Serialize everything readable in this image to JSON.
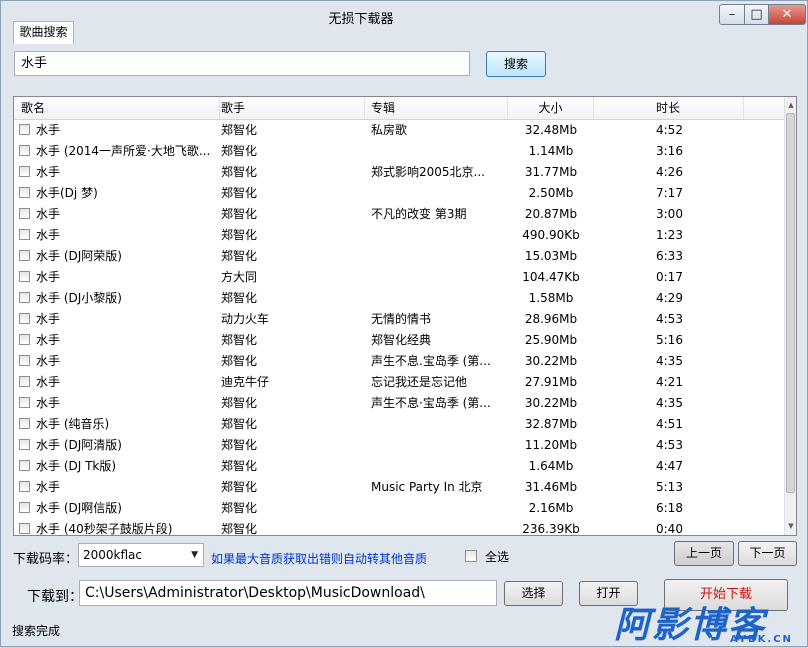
{
  "window": {
    "title": "无损下载器",
    "min_glyph": "–",
    "max_glyph": "□",
    "close_glyph": "✕"
  },
  "tab": {
    "label": "歌曲搜索"
  },
  "search": {
    "value": "水手",
    "button_label": "搜索"
  },
  "list": {
    "columns": [
      "歌名",
      "歌手",
      "专辑",
      "大小",
      "时长"
    ],
    "rows": [
      {
        "title": "水手",
        "artist": "郑智化",
        "album": "私房歌",
        "size": "32.48Mb",
        "duration": "4:52"
      },
      {
        "title": "水手 (2014一声所爱·大地飞歌...",
        "artist": "郑智化",
        "album": "",
        "size": "1.14Mb",
        "duration": "3:16"
      },
      {
        "title": "水手",
        "artist": "郑智化",
        "album": "郑式影响2005北京...",
        "size": "31.77Mb",
        "duration": "4:26"
      },
      {
        "title": "水手(Dj 梦)",
        "artist": "郑智化",
        "album": "",
        "size": "2.50Mb",
        "duration": "7:17"
      },
      {
        "title": "水手",
        "artist": "郑智化",
        "album": "不凡的改变 第3期",
        "size": "20.87Mb",
        "duration": "3:00"
      },
      {
        "title": "水手",
        "artist": "郑智化",
        "album": "",
        "size": "490.90Kb",
        "duration": "1:23"
      },
      {
        "title": "水手 (DJ阿荣版)",
        "artist": "郑智化",
        "album": "",
        "size": "15.03Mb",
        "duration": "6:33"
      },
      {
        "title": "水手",
        "artist": "方大同",
        "album": "",
        "size": "104.47Kb",
        "duration": "0:17"
      },
      {
        "title": "水手 (DJ小黎版)",
        "artist": "郑智化",
        "album": "",
        "size": "1.58Mb",
        "duration": "4:29"
      },
      {
        "title": "水手",
        "artist": "动力火车",
        "album": "无情的情书",
        "size": "28.96Mb",
        "duration": "4:53"
      },
      {
        "title": "水手",
        "artist": "郑智化",
        "album": "郑智化经典",
        "size": "25.90Mb",
        "duration": "5:16"
      },
      {
        "title": "水手",
        "artist": "郑智化",
        "album": "声生不息.宝岛季 (第...",
        "size": "30.22Mb",
        "duration": "4:35"
      },
      {
        "title": "水手",
        "artist": "迪克牛仔",
        "album": "忘记我还是忘记他",
        "size": "27.91Mb",
        "duration": "4:21"
      },
      {
        "title": "水手",
        "artist": "郑智化",
        "album": "声生不息·宝岛季 (第...",
        "size": "30.22Mb",
        "duration": "4:35"
      },
      {
        "title": "水手 (纯音乐)",
        "artist": "郑智化",
        "album": "",
        "size": "32.87Mb",
        "duration": "4:51"
      },
      {
        "title": "水手 (DJ阿清版)",
        "artist": "郑智化",
        "album": "",
        "size": "11.20Mb",
        "duration": "4:53"
      },
      {
        "title": "水手 (DJ Tk版)",
        "artist": "郑智化",
        "album": "",
        "size": "1.64Mb",
        "duration": "4:47"
      },
      {
        "title": "水手",
        "artist": "郑智化",
        "album": "Music Party In 北京",
        "size": "31.46Mb",
        "duration": "5:13"
      },
      {
        "title": "水手 (DJ啊信版)",
        "artist": "郑智化",
        "album": "",
        "size": "2.16Mb",
        "duration": "6:18"
      },
      {
        "title": "水手 (40秒架子鼓版片段)",
        "artist": "郑智化",
        "album": "",
        "size": "236.39Kb",
        "duration": "0:40"
      }
    ]
  },
  "controls": {
    "bitrate_label": "下载码率：",
    "bitrate_value": "2000kflac",
    "hint": "如果最大音质获取出错则自动转其他音质",
    "select_all_label": "全选",
    "prev_page": "上一页",
    "next_page": "下一页",
    "download_to_label": "下载到：",
    "path_value": "C:\\Users\\Administrator\\Desktop\\MusicDownload\\",
    "choose_button": "选择",
    "open_button": "打开",
    "start_button": "开始下载"
  },
  "status": {
    "text": "搜索完成"
  },
  "watermark": {
    "main": "阿影博客",
    "sub": "AYBK.CN"
  },
  "colors": {
    "hint": "#0033cc",
    "start_button_text": "#d01010",
    "watermark": "#1e63c8"
  }
}
